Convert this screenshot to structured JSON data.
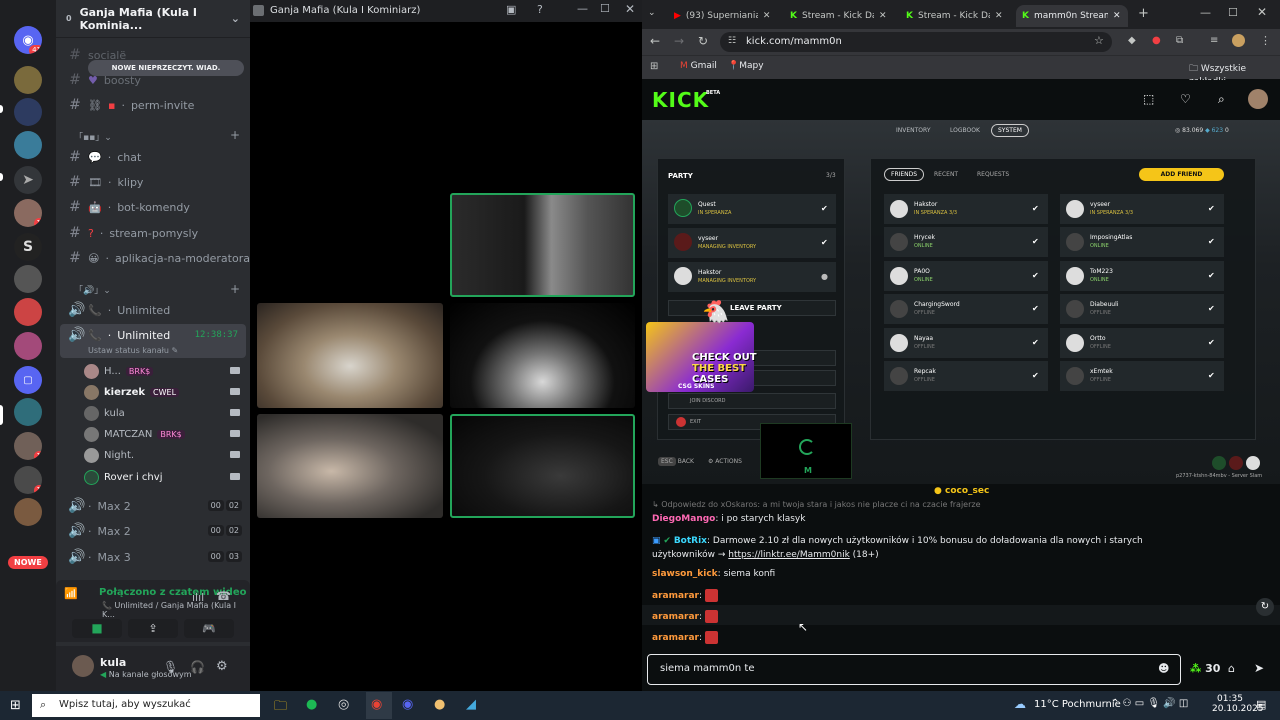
{
  "discord": {
    "server_badge": "41",
    "server_name": "Ganja Mafia (Kula I Kominia...",
    "unread_pill": "NOWE NIEPRZECZYT. WIAD.",
    "new_label": "NOWE",
    "partial_channels": [
      "socialë",
      "boosty"
    ],
    "text_channels": [
      {
        "name": "perm-invite",
        "icon": "link-icon"
      },
      {
        "name": "chat",
        "icon": "speech-icon"
      },
      {
        "name": "klipy",
        "icon": "clip-icon"
      },
      {
        "name": "bot-komendy",
        "icon": "robot-icon"
      },
      {
        "name": "stream-pomysly",
        "icon": "question-icon"
      },
      {
        "name": "aplikacja-na-moderatora",
        "icon": "emoji-icon"
      }
    ],
    "voice_channels": [
      {
        "name": "Unlimited",
        "active": false
      },
      {
        "name": "Unlimited",
        "active": true,
        "timer": "12:38:37",
        "status": "Ustaw status kanału"
      }
    ],
    "voice_users": [
      {
        "name": "H...",
        "tag": "BRK$"
      },
      {
        "name": "kierzek",
        "tag": "CWEL"
      },
      {
        "name": "kula",
        "tag": ""
      },
      {
        "name": "MATCZAN",
        "tag": "BRK$"
      },
      {
        "name": "Night.",
        "tag": ""
      },
      {
        "name": "Rover i chvj",
        "tag": ""
      }
    ],
    "max_channels": [
      {
        "name": "Max 2",
        "a": "00",
        "b": "02"
      },
      {
        "name": "Max 2",
        "a": "00",
        "b": "02"
      },
      {
        "name": "Max 3",
        "a": "00",
        "b": "03"
      }
    ],
    "connection": {
      "title": "Połączono z czatem wideo",
      "subtitle": "Unlimited / Ganja Mafia (Kula I K..."
    },
    "user": {
      "name": "kula",
      "status": "Na kanale głosowym"
    }
  },
  "stage": {
    "window_title": "Ganja Mafia (Kula I Kominiarz)"
  },
  "browser": {
    "tabs": [
      {
        "title": "(93) Superniania.St",
        "icon": "youtube-icon",
        "color": "#ff0000"
      },
      {
        "title": "Stream - Kick Dashb",
        "icon": "kick-icon",
        "color": "#53fc18"
      },
      {
        "title": "Stream - Kick Dashb",
        "icon": "kick-icon",
        "color": "#53fc18"
      },
      {
        "title": "mamm0n Stream -",
        "icon": "kick-icon",
        "color": "#53fc18"
      }
    ],
    "url": "kick.com/mamm0n",
    "bookmarks": [
      "Gmail",
      "Mapy"
    ],
    "all_bookmarks": "Wszystkie zakładki",
    "logo": "KICK",
    "logo_badge": "BETA",
    "stream_game": {
      "nav": [
        "INVENTORY",
        "LOGBOOK",
        "SYSTEM"
      ],
      "currency1": "83.069",
      "currency2": "623",
      "currency3": "0",
      "party_label": "PARTY",
      "party_count": "3/3",
      "party_members": [
        {
          "name": "Quest",
          "state": "IN SPERANZA"
        },
        {
          "name": "vyseer",
          "state": "MANAGING INVENTORY"
        },
        {
          "name": "Hakstor",
          "state": "MANAGING INVENTORY"
        }
      ],
      "leave_party": "LEAVE PARTY",
      "join_discord": "JOIN DISCORD",
      "exit": "EXIT",
      "friend_tabs": [
        "FRIENDS",
        "RECENT",
        "REQUESTS"
      ],
      "add_friend": "ADD FRIEND",
      "friends_left": [
        {
          "name": "Hakstor",
          "state": "IN SPERANZA 3/3"
        },
        {
          "name": "Hrycek",
          "state": "ONLINE"
        },
        {
          "name": "PA0O",
          "state": "ONLINE"
        },
        {
          "name": "ChargingSword",
          "state": "OFFLINE"
        },
        {
          "name": "Nayaa",
          "state": "OFFLINE"
        },
        {
          "name": "Repcak",
          "state": "OFFLINE"
        }
      ],
      "friends_right": [
        {
          "name": "vyseer",
          "state": "IN SPERANZA 3/3"
        },
        {
          "name": "ImposingAtlas",
          "state": "ONLINE"
        },
        {
          "name": "ToM223",
          "state": "ONLINE"
        },
        {
          "name": "Diabeuuli",
          "state": "OFFLINE"
        },
        {
          "name": "Ortto",
          "state": "OFFLINE"
        },
        {
          "name": "xEmtek",
          "state": "OFFLINE"
        }
      ],
      "ad_line1": "CHECK OUT",
      "ad_line2": "THE BEST",
      "ad_line3": "CASES",
      "ad_brand": "CSG SKINS",
      "back": "BACK",
      "actions": "ACTIONS",
      "server_id": "p2737-ktshn-84mbv - Server Slam"
    },
    "chat": {
      "pinned_user": "coco_sec",
      "reply_preview": "Odpowiedz do xOskaros: a mi twoja stara i jakos nie placze ci na czacie frajerze",
      "messages": [
        {
          "user": "DiegoMango",
          "color": "#ff69b4",
          "text": "i po starych klasyk"
        },
        {
          "user": "BotRix",
          "color": "#3bd9ff",
          "text": "Darmowe 2.10 zł dla nowych użytkowników i 10% bonusu do doładowania dla nowych i starych użytkowników →",
          "link": "https://linktr.ee/Mamm0nik",
          "extra": "(18+)"
        },
        {
          "user": "slawson_kick",
          "color": "#ff9a3c",
          "text": "siema konfi"
        },
        {
          "user": "aramarar",
          "color": "#ff9a3c",
          "text": ""
        },
        {
          "user": "aramarar",
          "color": "#ff9a3c",
          "text": ""
        },
        {
          "user": "aramarar",
          "color": "#ff9a3c",
          "text": ""
        }
      ],
      "input_value": "siema mamm0n te",
      "points": "30"
    }
  },
  "taskbar": {
    "search_placeholder": "Wpisz tutaj, aby wyszukać",
    "weather": "11°C  Pochmurnie",
    "time": "01:35",
    "date": "20.10.2025"
  },
  "colors": {
    "kick_green": "#53fc18",
    "discord_green": "#23a55a",
    "discord_red": "#f23f43"
  }
}
